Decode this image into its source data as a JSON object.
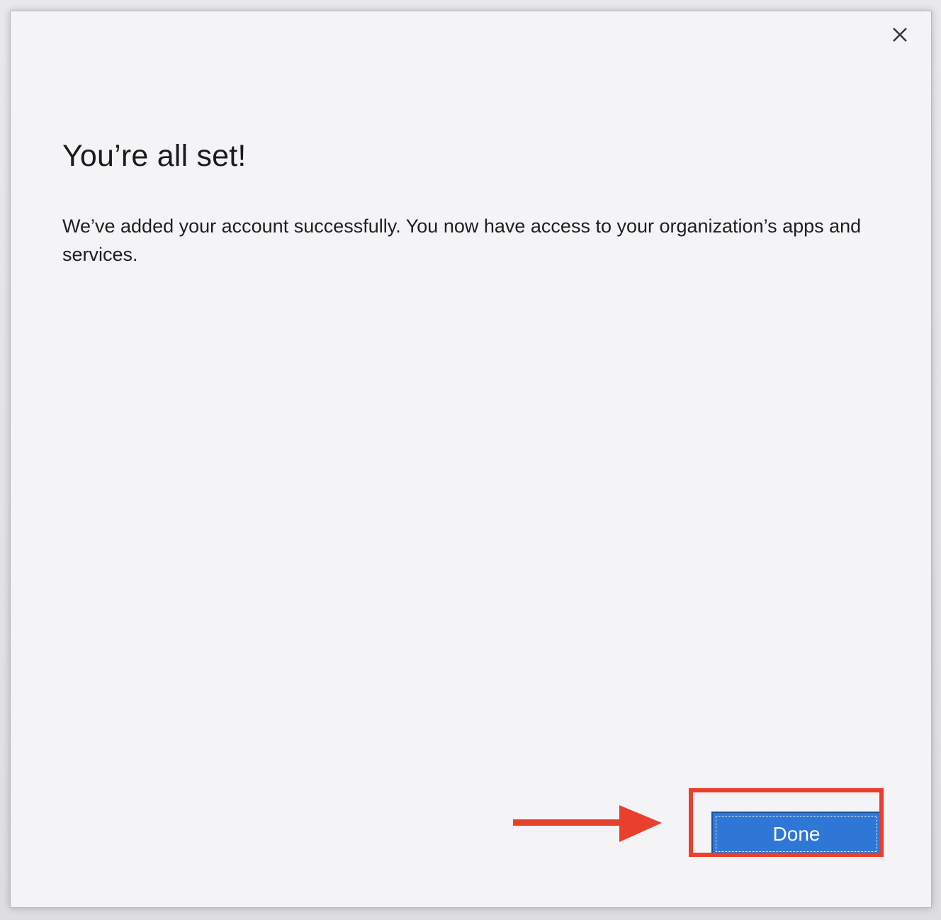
{
  "dialog": {
    "close_icon": "close-icon",
    "title": "You’re all set!",
    "message": "We’ve added your account successfully. You now have access to your organization’s apps and services.",
    "done_label": "Done"
  },
  "annotation": {
    "arrow_icon": "arrow-right-icon",
    "color": "#e8402c"
  },
  "colors": {
    "accent": "#2f77d6",
    "dialog_background": "#f4f3f6"
  }
}
